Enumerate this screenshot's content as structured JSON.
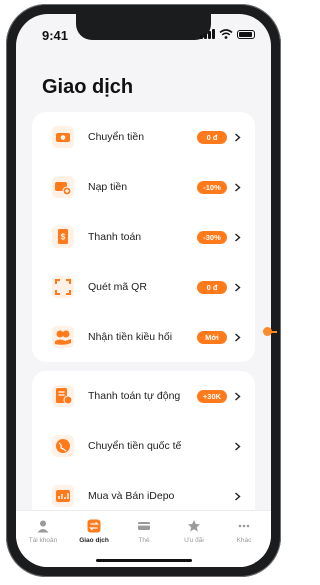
{
  "status": {
    "time": "9:41"
  },
  "page_title": "Giao dịch",
  "menu": {
    "group1": [
      {
        "label": "Chuyển tiền",
        "badge": "0 đ",
        "icon": "money-transfer-icon"
      },
      {
        "label": "Nạp tiền",
        "badge": "-10%",
        "icon": "wallet-topup-icon"
      },
      {
        "label": "Thanh toán",
        "badge": "-30%",
        "icon": "bill-payment-icon"
      },
      {
        "label": "Quét mã QR",
        "badge": "0 đ",
        "icon": "qr-scan-icon"
      },
      {
        "label": "Nhận tiền kiều hối",
        "badge": "Mới",
        "icon": "remittance-icon"
      }
    ],
    "group2": [
      {
        "label": "Thanh toán tự động",
        "badge": "+30K",
        "icon": "auto-payment-icon"
      },
      {
        "label": "Chuyển tiền quốc tế",
        "badge": "",
        "icon": "globe-icon"
      },
      {
        "label": "Mua và Bán iDepo",
        "badge": "",
        "icon": "chart-icon"
      }
    ]
  },
  "tabs": [
    {
      "label": "Tài khoản",
      "icon": "person-icon",
      "active": false
    },
    {
      "label": "Giao dịch",
      "icon": "transaction-icon",
      "active": true
    },
    {
      "label": "Thẻ",
      "icon": "card-icon",
      "active": false
    },
    {
      "label": "Ưu đãi",
      "icon": "star-icon",
      "active": false
    },
    {
      "label": "Khác",
      "icon": "more-icon",
      "active": false
    }
  ],
  "colors": {
    "accent": "#ff7a1a",
    "icon_bg": "#fff1e6",
    "inactive": "#9a9a9a"
  }
}
